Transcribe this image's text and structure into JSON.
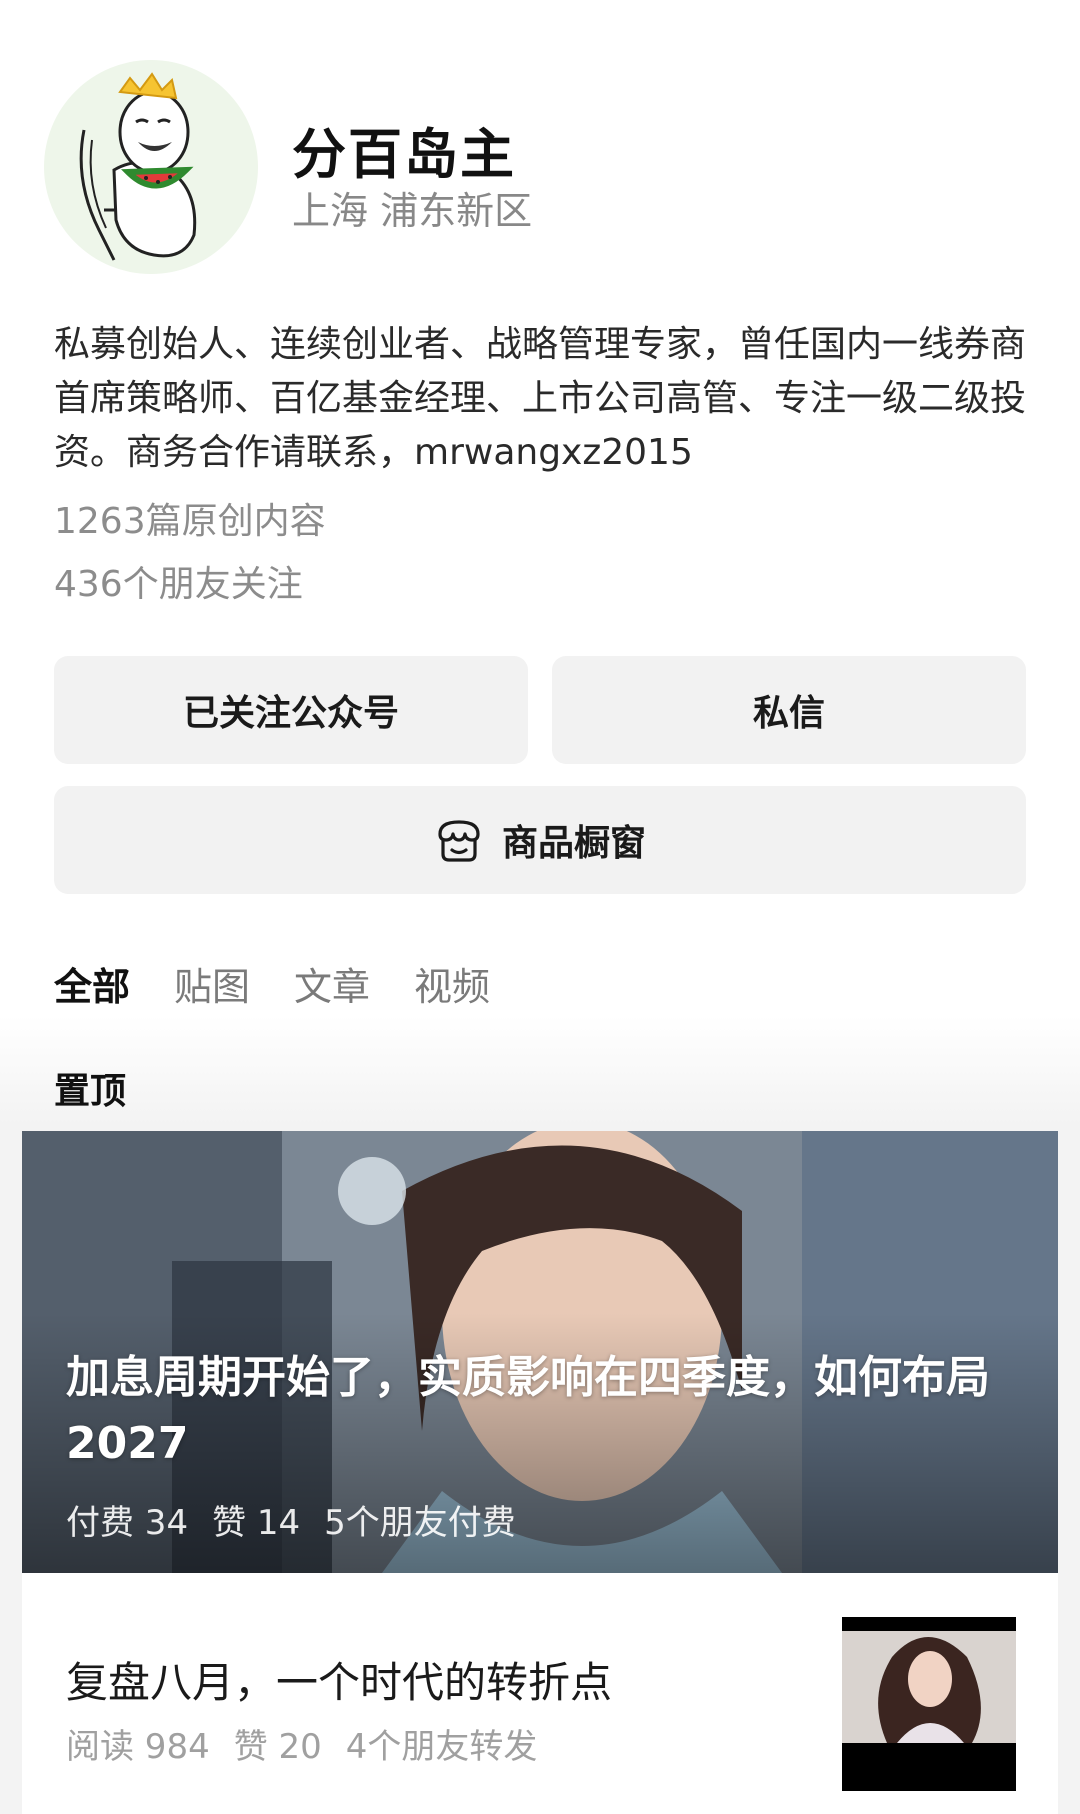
{
  "profile": {
    "name": "分百岛主",
    "location": "上海 浦东新区",
    "bio": "私募创始人、连续创业者、战略管理专家，曾任国内一线券商首席策略师、百亿基金经理、上市公司高管、专注一级二级投资。商务合作请联系，mrwangxz2015",
    "original_count": "1263篇原创内容",
    "friends_following": "436个朋友关注"
  },
  "actions": {
    "follow_label": "已关注公众号",
    "message_label": "私信",
    "shop_label": "商品橱窗",
    "shop_icon": "shop-icon"
  },
  "tabs": [
    {
      "label": "全部",
      "active": true
    },
    {
      "label": "贴图",
      "active": false
    },
    {
      "label": "文章",
      "active": false
    },
    {
      "label": "视频",
      "active": false
    }
  ],
  "pinned": {
    "section_label": "置顶",
    "title": "加息周期开始了，实质影响在四季度，如何布局2027",
    "paid": "付费 34",
    "likes": "赞 14",
    "friends_paid": "5个朋友付费"
  },
  "articles": [
    {
      "title": "复盘八月，一个时代的转折点",
      "reads": "阅读 984",
      "likes": "赞 20",
      "friends_shared": "4个朋友转发"
    }
  ],
  "colors": {
    "button_bg": "#f2f2f2",
    "muted_text": "#8c8c8c",
    "avatar_bg": "#eef6ea"
  }
}
